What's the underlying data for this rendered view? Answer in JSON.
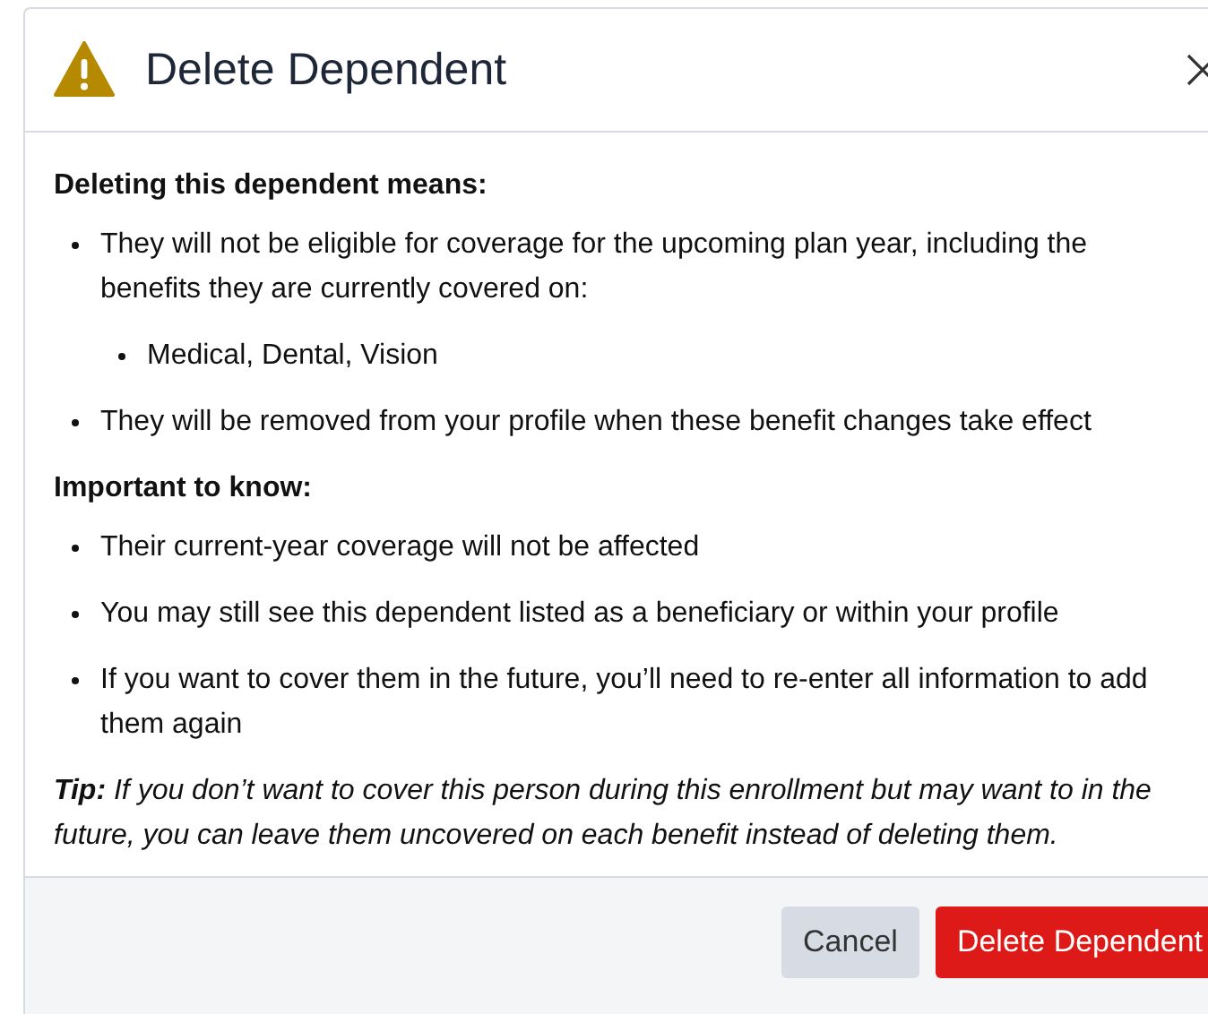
{
  "dialog": {
    "title": "Delete Dependent",
    "sections": [
      {
        "heading": "Deleting this dependent means:",
        "items": [
          {
            "text": "They will not be eligible for coverage for the upcoming plan year, including the benefits they are currently covered on:",
            "children": [
              {
                "text": "Medical, Dental, Vision"
              }
            ]
          },
          {
            "text": "They will be removed from your profile when these benefit changes take effect"
          }
        ]
      },
      {
        "heading": "Important to know:",
        "items": [
          {
            "text": "Their current-year coverage will not be affected"
          },
          {
            "text": "You may still see this dependent listed as a beneficiary or within your profile"
          },
          {
            "text": "If you want to cover them in the future, you’ll need to re-enter all information to add them again"
          }
        ]
      }
    ],
    "tip": "**Tip:** If you don’t want to cover this person during this enrollment but may want to in the future, you can leave them uncovered on each benefit instead of deleting them.",
    "buttons": [
      {
        "label": "Cancel",
        "kind": "secondary"
      },
      {
        "label": "Delete Dependent",
        "kind": "danger"
      }
    ]
  }
}
